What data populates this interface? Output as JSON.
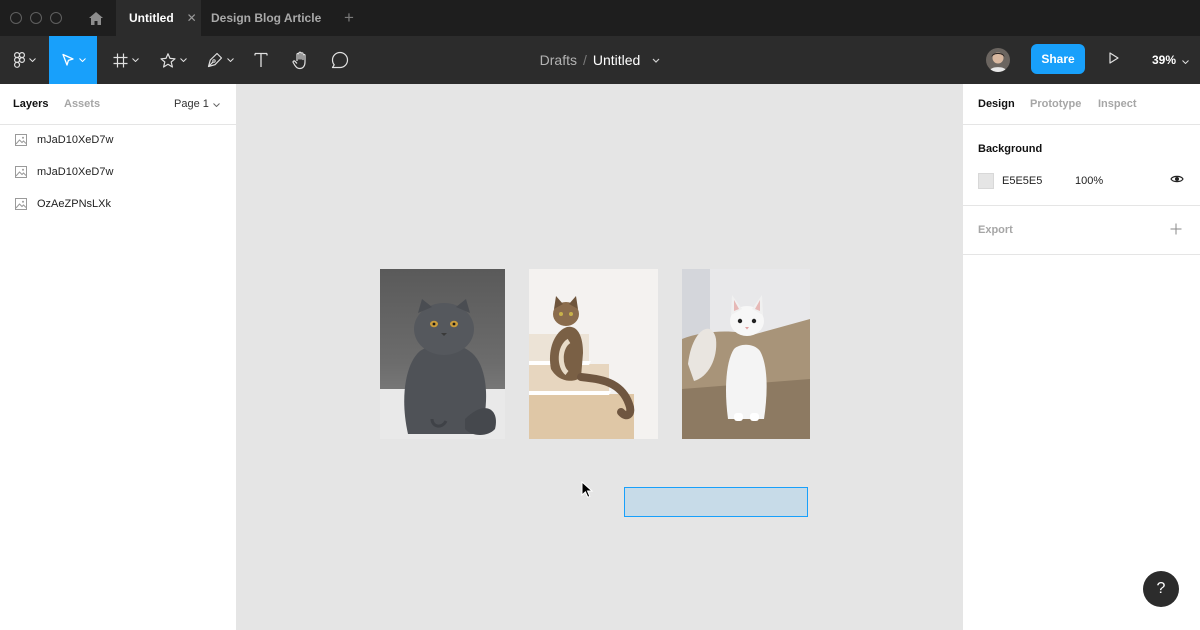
{
  "tabs": [
    {
      "label": "Untitled",
      "active": true
    },
    {
      "label": "Design Blog Article",
      "active": false
    }
  ],
  "toolbar": {
    "breadcrumb_parent": "Drafts",
    "breadcrumb_sep": "/",
    "file_title": "Untitled",
    "share_label": "Share",
    "zoom": "39%",
    "tools": [
      "main-menu-icon",
      "move-icon",
      "frame-icon",
      "shape-icon",
      "pen-icon",
      "text-icon",
      "hand-icon",
      "comment-icon"
    ],
    "accent": "#18a0fb"
  },
  "left_panel": {
    "tab_layers": "Layers",
    "tab_assets": "Assets",
    "page": "Page 1",
    "layers": [
      {
        "name": "mJaD10XeD7w"
      },
      {
        "name": "mJaD10XeD7w"
      },
      {
        "name": "OzAeZPNsLXk"
      }
    ]
  },
  "right_panel": {
    "tab_design": "Design",
    "tab_prototype": "Prototype",
    "tab_inspect": "Inspect",
    "background_title": "Background",
    "background_hex": "E5E5E5",
    "background_opacity": "100%",
    "background_color": "#e5e5e5",
    "export_title": "Export",
    "help_label": "?"
  }
}
